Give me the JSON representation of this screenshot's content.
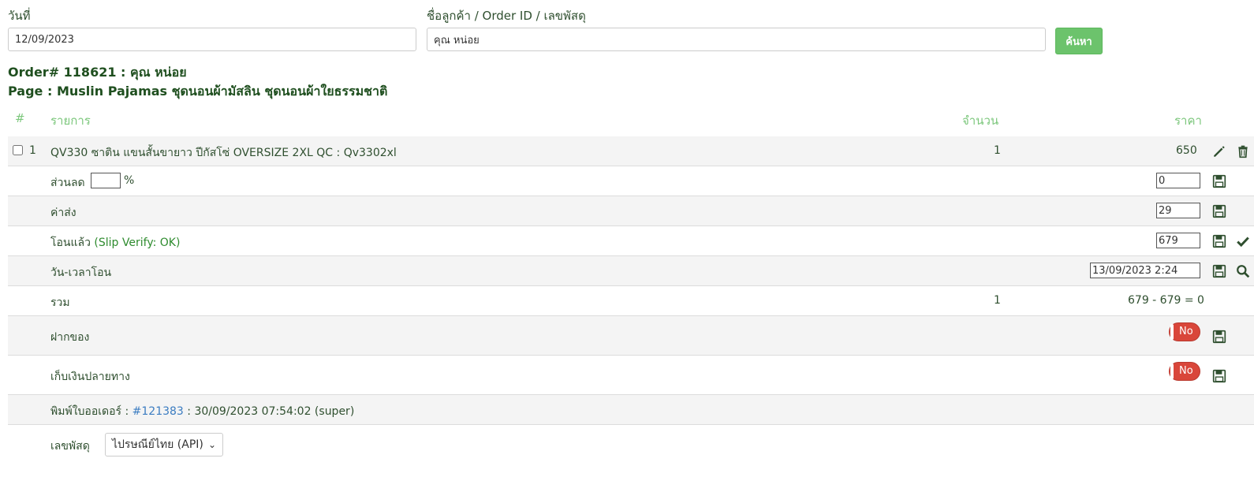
{
  "filters": {
    "date_label": "วันที่",
    "date_value": "12/09/2023",
    "customer_label": "ชื่อลูกค้า / Order ID / เลขพัสดุ",
    "customer_value": "คุณ หน่อย",
    "search_button": "ค้นหา"
  },
  "order": {
    "title": "Order# 118621 : คุณ หน่อย",
    "page": "Page : Muslin Pajamas ชุดนอนผ้ามัสลิน ชุดนอนผ้าใยธรรมชาติ"
  },
  "table": {
    "headers": {
      "index": "#",
      "item": "รายการ",
      "qty": "จำนวน",
      "price": "ราคา"
    },
    "item": {
      "index": "1",
      "name": "QV330 ซาติน แขนสั้นขายาว ปีกัสโซ่ OVERSIZE 2XL QC : Qv3302xl",
      "qty": "1",
      "price": "650"
    },
    "discount": {
      "label": "ส่วนลด",
      "percent_value": "",
      "percent_sign": "%",
      "value": "0"
    },
    "shipping": {
      "label": "ค่าส่ง",
      "value": "29"
    },
    "paid": {
      "label": "โอนแล้ว",
      "verify": "(Slip Verify: OK)",
      "value": "679"
    },
    "transfer_time": {
      "label": "วัน-เวลาโอน",
      "value": "13/09/2023 2:24"
    },
    "total": {
      "label": "รวม",
      "qty": "1",
      "calc": "679 - 679 = 0"
    },
    "deposit": {
      "label": "ฝากของ",
      "toggle": "No"
    },
    "cod": {
      "label": "เก็บเงินปลายทาง",
      "toggle": "No"
    },
    "print": {
      "label": "พิมพ์ใบออเดอร์ :",
      "link": "#121383",
      "info": ": 30/09/2023 07:54:02 (super)"
    },
    "tracking": {
      "label": "เลขพัสดุ",
      "carrier": "ไปรษณีย์ไทย (API)"
    }
  },
  "colors": {
    "header_green": "#7cc77c",
    "button_green": "#6cc36c",
    "toggle_red": "#d9463a",
    "link_blue": "#3b7cc1",
    "text_dark_green": "#2f4f2f"
  },
  "icons": [
    "pencil-icon",
    "trash-icon",
    "save-icon",
    "check-icon",
    "search-icon",
    "chevron-down-icon"
  ]
}
